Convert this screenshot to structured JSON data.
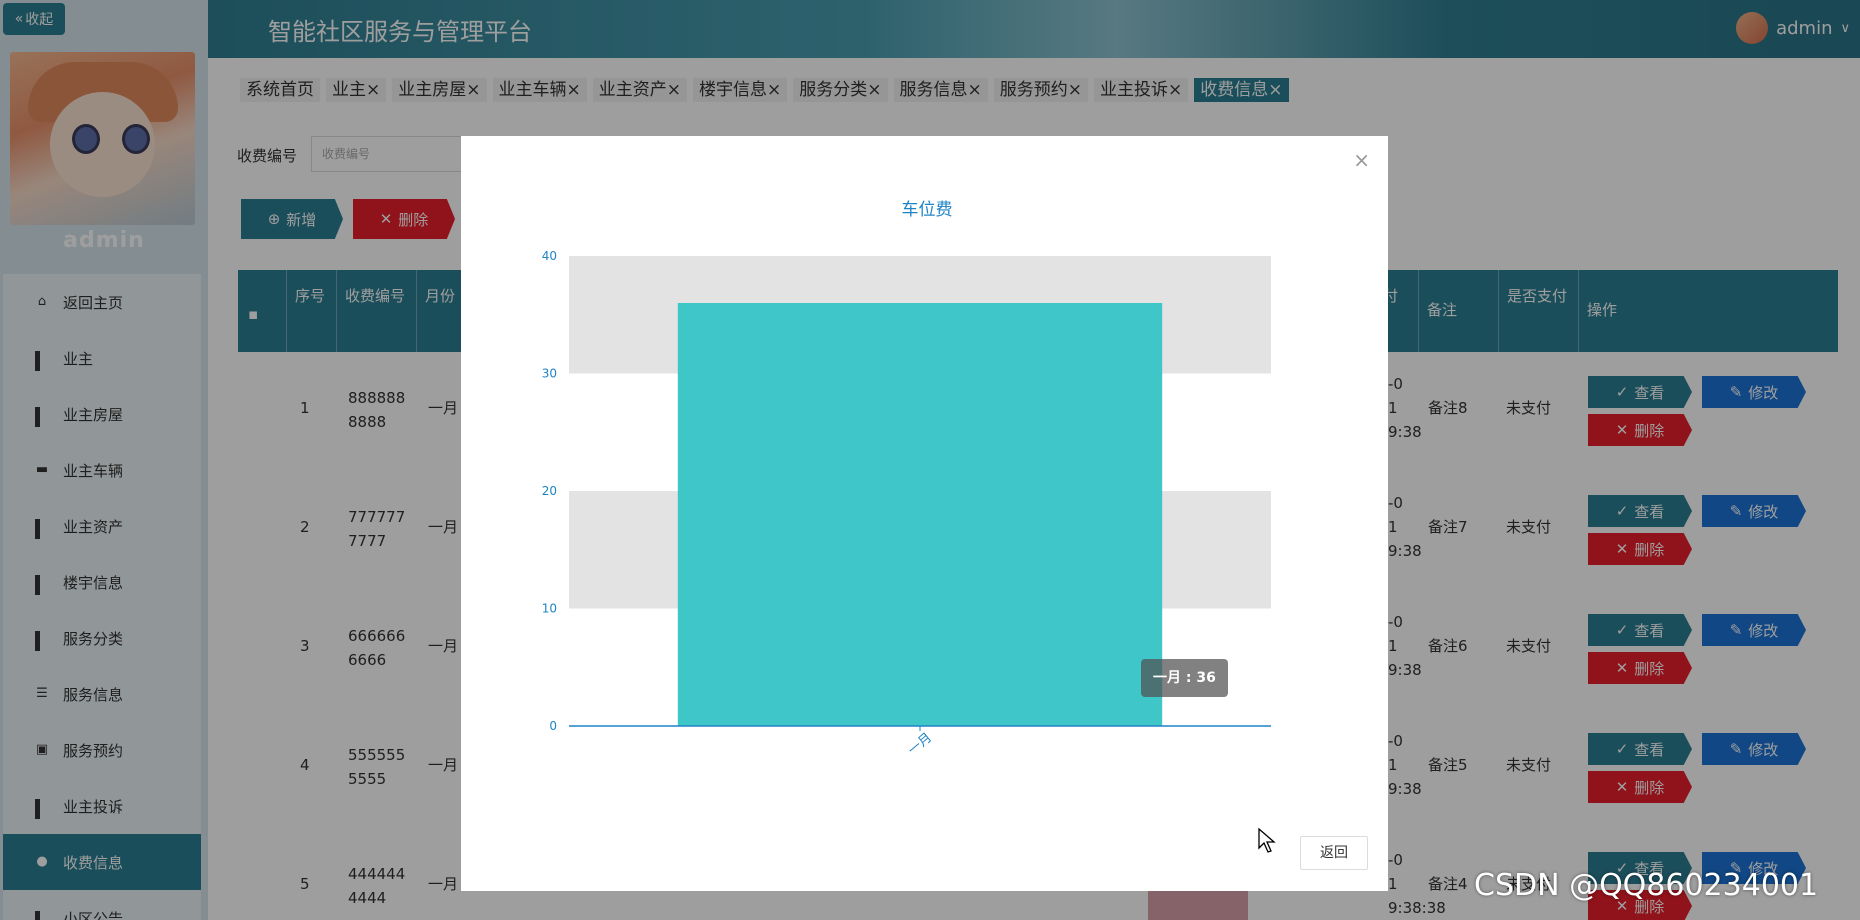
{
  "header": {
    "title": "智能社区服务与管理平台",
    "user": "admin",
    "user_caret": "∨"
  },
  "sidebar": {
    "collapse_label": "收起",
    "user_name": "admin",
    "items": [
      {
        "label": "返回主页",
        "icon": "home-icon"
      },
      {
        "label": "业主",
        "icon": "grid-icon"
      },
      {
        "label": "业主房屋",
        "icon": "grid-icon"
      },
      {
        "label": "业主车辆",
        "icon": "car-icon"
      },
      {
        "label": "业主资产",
        "icon": "grid-icon"
      },
      {
        "label": "楼宇信息",
        "icon": "grid-icon"
      },
      {
        "label": "服务分类",
        "icon": "grid-icon"
      },
      {
        "label": "服务信息",
        "icon": "sliders-icon"
      },
      {
        "label": "服务预约",
        "icon": "briefcase-icon"
      },
      {
        "label": "业主投诉",
        "icon": "grid-icon"
      },
      {
        "label": "收费信息",
        "icon": "user-icon",
        "active": true
      },
      {
        "label": "小区公告",
        "icon": "grid-icon"
      }
    ]
  },
  "tabs": [
    {
      "label": "系统首页",
      "closable": false
    },
    {
      "label": "业主",
      "closable": true
    },
    {
      "label": "业主房屋",
      "closable": true
    },
    {
      "label": "业主车辆",
      "closable": true
    },
    {
      "label": "业主资产",
      "closable": true
    },
    {
      "label": "楼宇信息",
      "closable": true
    },
    {
      "label": "服务分类",
      "closable": true
    },
    {
      "label": "服务信息",
      "closable": true
    },
    {
      "label": "服务预约",
      "closable": true
    },
    {
      "label": "业主投诉",
      "closable": true
    },
    {
      "label": "收费信息",
      "closable": true,
      "active": true
    }
  ],
  "tab_close_glyph": "×",
  "search": {
    "label": "收费编号",
    "placeholder": "收费编号"
  },
  "toolbar": {
    "add_label": "新增",
    "delete_label": "删除"
  },
  "table": {
    "headers": {
      "index": "序号",
      "fee_no": "收费编号",
      "month": "月份",
      "pay_time_partial": "付",
      "remark": "备注",
      "paid": "是否支付",
      "actions": "操作"
    },
    "rows": [
      {
        "index": "1",
        "fee_no": "8888888888",
        "month": "一月",
        "time": [
          "-0",
          "1",
          "9:38"
        ],
        "remark": "备注8",
        "paid": "未支付"
      },
      {
        "index": "2",
        "fee_no": "7777777777",
        "month": "一月",
        "time": [
          "-0",
          "1",
          "9:38"
        ],
        "remark": "备注7",
        "paid": "未支付"
      },
      {
        "index": "3",
        "fee_no": "6666666666",
        "month": "一月",
        "time": [
          "-0",
          "1",
          "9:38"
        ],
        "remark": "备注6",
        "paid": "未支付"
      },
      {
        "index": "4",
        "fee_no": "5555555555",
        "month": "一月",
        "time": [
          "-0",
          "1",
          "9:38"
        ],
        "remark": "备注5",
        "paid": "未支付"
      },
      {
        "index": "5",
        "fee_no": "4444444444",
        "month": "一月",
        "time": [
          "-0",
          "1",
          "9:38:38"
        ],
        "remark": "备注4",
        "paid": "未支付"
      }
    ],
    "view_label": "查看",
    "edit_label": "修改",
    "delete_label": "删除"
  },
  "modal": {
    "close_glyph": "×",
    "back_label": "返回",
    "tooltip": "一月 : 36"
  },
  "chart_data": {
    "type": "bar",
    "title": "车位费",
    "categories": [
      "一月"
    ],
    "values": [
      36
    ],
    "ylim": [
      0,
      40
    ],
    "yticks": [
      0,
      10,
      20,
      30,
      40
    ],
    "grid": true,
    "colors": {
      "bar": "#3ec6c9",
      "axis": "#1f84c6",
      "title": "#1f84c6",
      "band": "#e3e3e3"
    }
  },
  "watermark": "CSDN @QQ860234001"
}
